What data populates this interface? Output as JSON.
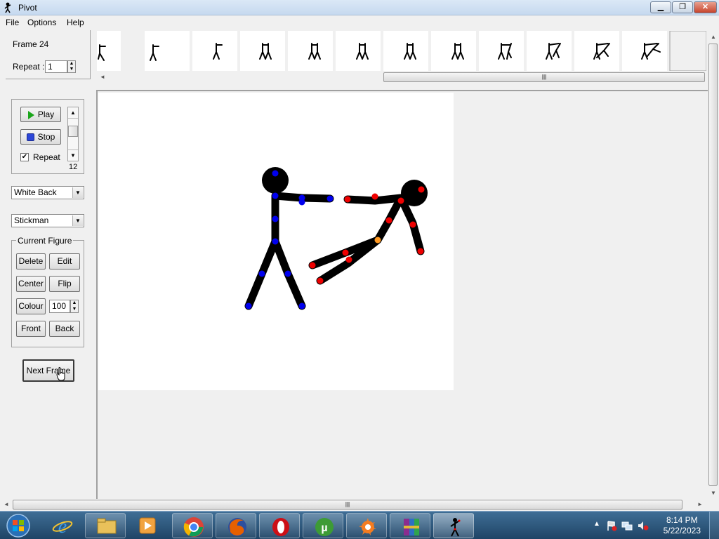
{
  "window": {
    "title": "Pivot"
  },
  "menu": [
    "File",
    "Options",
    "Help"
  ],
  "frame_info": {
    "frame_label": "Frame 24",
    "repeat_label": "Repeat :",
    "repeat_value": "1"
  },
  "playback": {
    "play_label": "Play",
    "stop_label": "Stop",
    "repeat_checkbox_label": "Repeat",
    "repeat_checked": true,
    "speed_value": "12"
  },
  "background_select": {
    "value": "White Back"
  },
  "figure_type_select": {
    "value": "Stickman"
  },
  "current_figure": {
    "legend": "Current Figure",
    "delete_label": "Delete",
    "edit_label": "Edit",
    "center_label": "Center",
    "flip_label": "Flip",
    "colour_label": "Colour",
    "colour_value": "100",
    "front_label": "Front",
    "back_label": "Back"
  },
  "next_frame_label": "Next Frame",
  "filmstrip": {
    "thumbnail_count": 12
  },
  "colors": {
    "joint_blue": "#0000ee",
    "joint_red": "#ee0000",
    "joint_orange": "#ff9922",
    "figure": "#000000",
    "canvas": "#ffffff"
  },
  "taskbar": {
    "apps": [
      "windows-explorer",
      "internet-explorer",
      "file-explorer",
      "media-player",
      "chrome",
      "firefox",
      "opera",
      "utorrent",
      "avast",
      "winrar",
      "pivot"
    ],
    "time": "8:14 PM",
    "date": "5/22/2023"
  }
}
